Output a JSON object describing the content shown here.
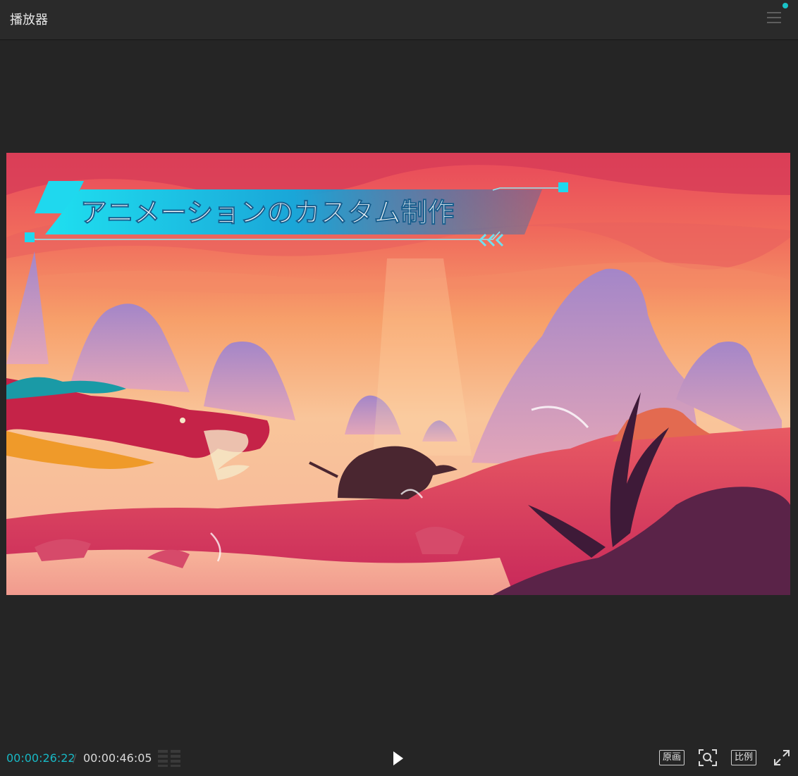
{
  "window": {
    "title": "播放器"
  },
  "header": {
    "menu_icon": "hamburger-menu-icon",
    "notification_color": "#19c3c7"
  },
  "video": {
    "title_overlay": "アニメーションのカスタム制作",
    "accent_color": "#19c3c7"
  },
  "controls": {
    "current_time": "00:00:26:22",
    "separator": "/",
    "total_time": "00:00:46:05",
    "original_label": "原画",
    "ratio_label": "比例",
    "current_time_color": "#18b8c4",
    "icons": [
      "waveform-icon",
      "play-icon",
      "zoom-icon",
      "fullscreen-icon"
    ]
  }
}
